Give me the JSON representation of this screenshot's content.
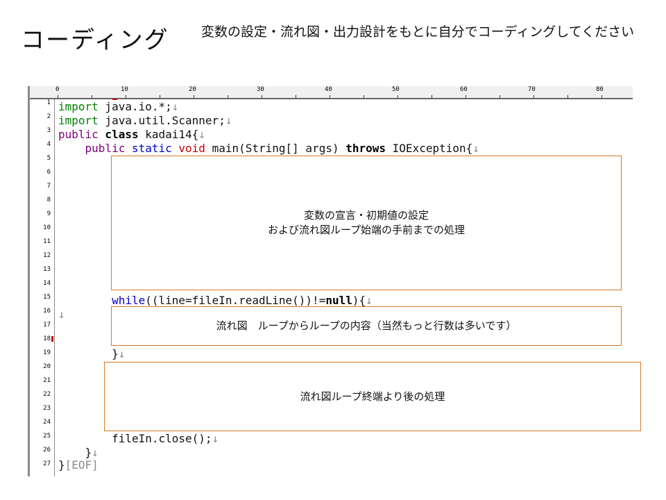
{
  "title": "コーディング",
  "note": "変数の設定・流れ図・出力設計をもとに自分でコーディングしてください",
  "ruler": {
    "labels": [
      "0",
      "10",
      "20",
      "30",
      "40",
      "50",
      "60",
      "70",
      "80"
    ]
  },
  "line_numbers": [
    "1",
    "2",
    "3",
    "4",
    "5",
    "6",
    "7",
    "8",
    "9",
    "10",
    "11",
    "12",
    "13",
    "14",
    "15",
    "16",
    "17",
    "18",
    "19",
    "20",
    "21",
    "22",
    "23",
    "24",
    "25",
    "26",
    "27"
  ],
  "code": {
    "l1_kw": "import",
    "l1_rest": " java.io.*;",
    "nl": "↓",
    "l2_kw": "import",
    "l2_rest": " java.util.Scanner;",
    "l3_kw1": "public",
    "l3_kw2": " class",
    "l3_rest": " kadai14{",
    "l4_indent": "    ",
    "l4_kw1": "public",
    "l4_kw2": " static",
    "l4_kw3": " void",
    "l4_mid": " main(String[] args) ",
    "l4_kw4": "throws",
    "l4_rest": " IOException{",
    "l15_indent": "        ",
    "l15_kw": "while",
    "l15_mid": "((line=fileIn.readLine())!=",
    "l15_kw2": "null",
    "l15_rest": "){",
    "l16": "↓",
    "l19_indent": "        ",
    "l19": "}",
    "l25_indent": "        ",
    "l25": "fileIn.close();",
    "l26_indent": "    ",
    "l26": "}",
    "l27": "}",
    "l27_eof": "[EOF]"
  },
  "boxes": {
    "declare_line1": "変数の宣言・初期値の設定",
    "declare_line2": "および流れ図ループ始端の手前までの処理",
    "loop": "流れ図　ループからループの内容（当然もっと行数は多いです）",
    "after": "流れ図ループ終端より後の処理"
  }
}
